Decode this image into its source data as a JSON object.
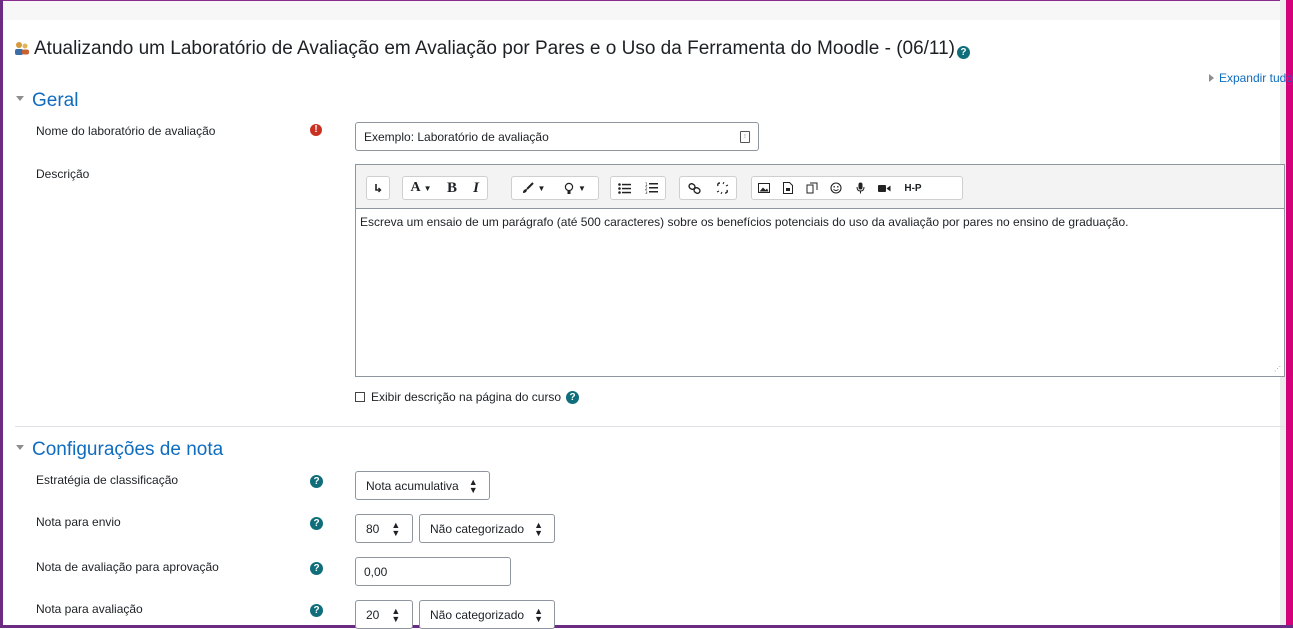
{
  "page": {
    "title": "Atualizando um Laboratório de Avaliação em Avaliação por Pares e o Uso da Ferramenta do Moodle - (06/11)",
    "expand_all": "Expandir tudo"
  },
  "general": {
    "heading": "Geral",
    "name_label": "Nome do laboratório de avaliação",
    "name_value": "Exemplo: Laboratório de avaliação",
    "description_label": "Descrição",
    "description_text": "Escreva um ensaio de um parágrafo (até 500 caracteres) sobre os benefícios potenciais do uso da avaliação por pares no ensino de graduação.",
    "show_description_label": "Exibir descrição na página do curso",
    "show_description_checked": false
  },
  "editor_toolbar": {
    "buttons": [
      "collapse-toggle",
      "font-style",
      "bold",
      "italic",
      "text-color",
      "highlight",
      "unordered-list",
      "ordered-list",
      "link",
      "unlink",
      "image",
      "media",
      "manage-files",
      "emoji",
      "record-audio",
      "record-video",
      "h5p"
    ],
    "bold_glyph": "B",
    "italic_glyph": "I",
    "font_glyph": "A",
    "h5p_glyph": "H-P"
  },
  "grades": {
    "heading": "Configurações de nota",
    "strategy_label": "Estratégia de classificação",
    "strategy_value": "Nota acumulativa",
    "submission_grade_label": "Nota para envio",
    "submission_grade_value": "80",
    "submission_category_value": "Não categorizado",
    "assessment_pass_label": "Nota de avaliação para aprovação",
    "assessment_pass_value": "0,00",
    "assessment_grade_label": "Nota para avaliação",
    "assessment_grade_value": "20",
    "assessment_category_value": "Não categorizado"
  },
  "colors": {
    "link": "#0f6cbf",
    "required": "#ca3120",
    "help": "#0f6e7a",
    "frame_right": "#d4007a",
    "frame_left": "#6b2b83"
  }
}
